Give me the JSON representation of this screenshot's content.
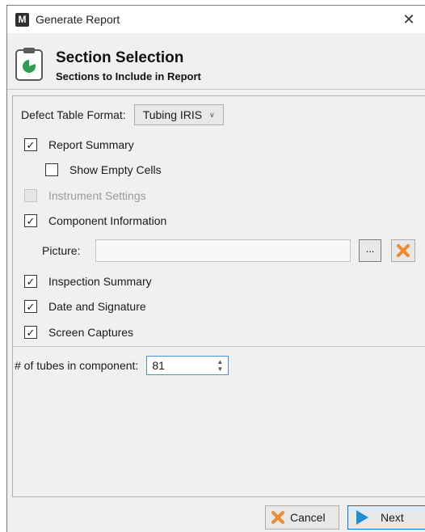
{
  "window": {
    "title": "Generate Report",
    "logo_letter": "M",
    "close_glyph": "✕"
  },
  "header": {
    "title": "Section Selection",
    "subtitle": "Sections to Include in Report",
    "icon": "clipboard-pie-icon"
  },
  "form": {
    "defect_table_format_label": "Defect Table Format:",
    "defect_table_format_value": "Tubing IRIS",
    "report_summary": {
      "label": "Report Summary",
      "checked": true
    },
    "show_empty_cells": {
      "label": "Show Empty Cells",
      "checked": false
    },
    "instrument_settings": {
      "label": "Instrument Settings",
      "checked": false,
      "disabled": true
    },
    "component_information": {
      "label": "Component Information",
      "checked": true
    },
    "picture_label": "Picture:",
    "picture_value": "",
    "browse_label": "...",
    "inspection_summary": {
      "label": "Inspection Summary",
      "checked": true
    },
    "date_and_signature": {
      "label": "Date and Signature",
      "checked": true
    },
    "screen_captures": {
      "label": "Screen Captures",
      "checked": true
    },
    "tubes_label": "# of tubes in component:",
    "tubes_value": "81"
  },
  "footer": {
    "cancel_label": "Cancel",
    "next_label": "Next"
  },
  "colors": {
    "accent": "#0078d7",
    "cancel_x": "#f0892f",
    "next_arrow": "#1e90d6",
    "icon_green": "#2f9e55"
  },
  "check_glyph": "✓"
}
